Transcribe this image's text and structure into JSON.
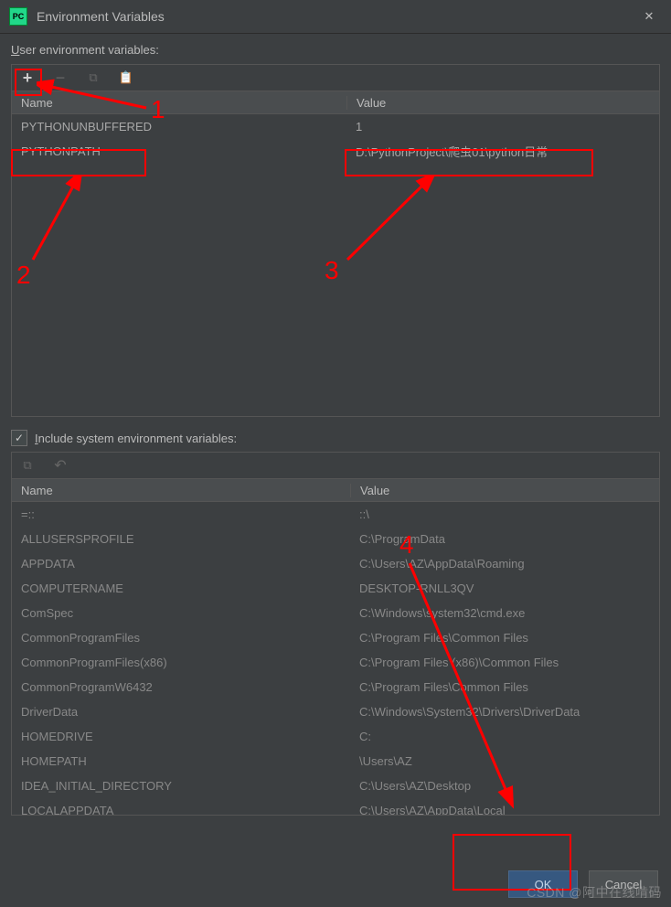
{
  "titlebar": {
    "app_icon_text": "PC",
    "title": "Environment Variables",
    "close_glyph": "✕"
  },
  "user_section": {
    "label_prefix": "U",
    "label_rest": "ser environment variables:",
    "toolbar": {
      "add_glyph": "+",
      "remove_glyph": "−",
      "copy_glyph": "⧉",
      "paste_glyph": "📋"
    },
    "columns": {
      "name": "Name",
      "value": "Value"
    },
    "rows": [
      {
        "name": "PYTHONUNBUFFERED",
        "value": "1"
      },
      {
        "name": "PYTHONPATH",
        "value": "D:\\PythonProject\\爬虫01\\python日常"
      }
    ]
  },
  "include_checkbox": {
    "checked_glyph": "✓",
    "label_prefix": "I",
    "label_rest": "nclude system environment variables:"
  },
  "system_section": {
    "toolbar": {
      "copy_glyph": "⧉",
      "undo_glyph": "↶"
    },
    "columns": {
      "name": "Name",
      "value": "Value"
    },
    "rows": [
      {
        "name": "=::",
        "value": "::\\"
      },
      {
        "name": "ALLUSERSPROFILE",
        "value": "C:\\ProgramData"
      },
      {
        "name": "APPDATA",
        "value": "C:\\Users\\AZ\\AppData\\Roaming"
      },
      {
        "name": "COMPUTERNAME",
        "value": "DESKTOP-RNLL3QV"
      },
      {
        "name": "ComSpec",
        "value": "C:\\Windows\\system32\\cmd.exe"
      },
      {
        "name": "CommonProgramFiles",
        "value": "C:\\Program Files\\Common Files"
      },
      {
        "name": "CommonProgramFiles(x86)",
        "value": "C:\\Program Files (x86)\\Common Files"
      },
      {
        "name": "CommonProgramW6432",
        "value": "C:\\Program Files\\Common Files"
      },
      {
        "name": "DriverData",
        "value": "C:\\Windows\\System32\\Drivers\\DriverData"
      },
      {
        "name": "HOMEDRIVE",
        "value": "C:"
      },
      {
        "name": "HOMEPATH",
        "value": "\\Users\\AZ"
      },
      {
        "name": "IDEA_INITIAL_DIRECTORY",
        "value": "C:\\Users\\AZ\\Desktop"
      },
      {
        "name": "LOCALAPPDATA",
        "value": "C:\\Users\\AZ\\AppData\\Local"
      }
    ]
  },
  "buttons": {
    "ok": "OK",
    "cancel": "Cancel"
  },
  "annotations": {
    "num1": "1",
    "num2": "2",
    "num3": "3",
    "num4": "4"
  },
  "watermark": "CSDN @阿中在线啃码"
}
